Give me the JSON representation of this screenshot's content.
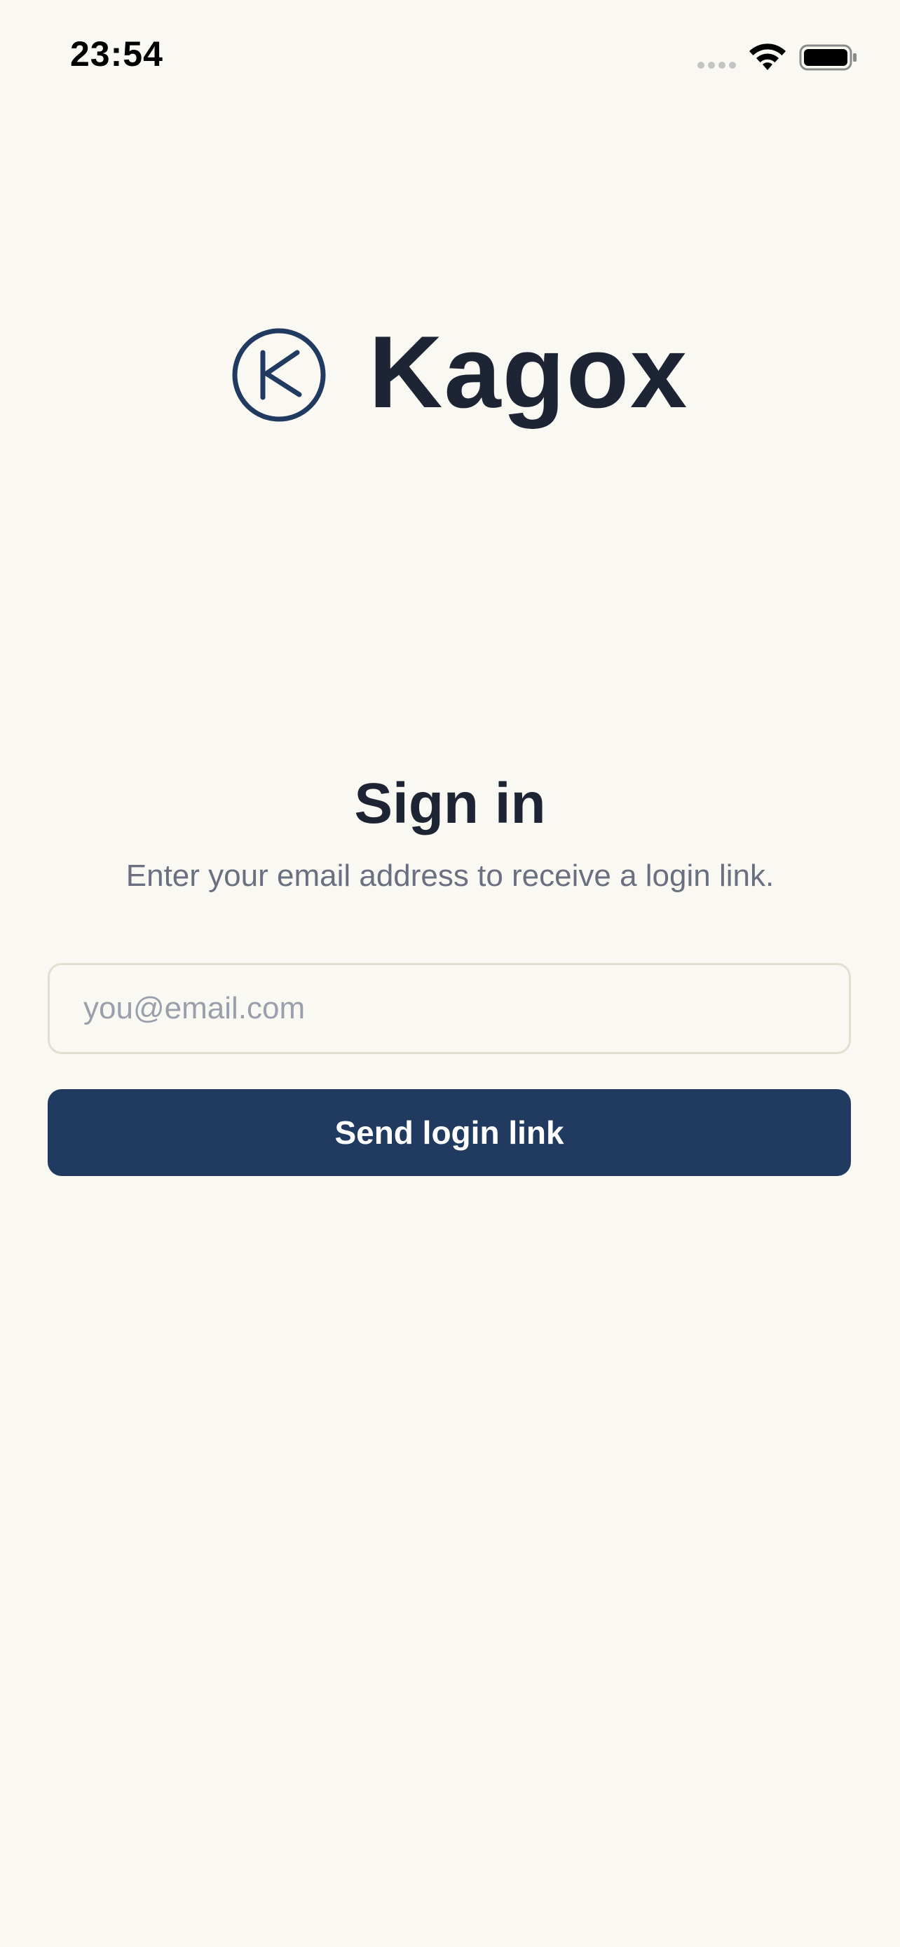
{
  "status_bar": {
    "time": "23:54",
    "icons": [
      "signal-icon",
      "wifi-icon",
      "battery-icon"
    ]
  },
  "brand": {
    "name": "Kagox",
    "logo_icon": "circle-k-logo-icon",
    "primary_color": "#203a60",
    "text_color": "#1d2433",
    "background_color": "#faf8f2"
  },
  "signin": {
    "title": "Sign in",
    "subtitle": "Enter your email address to receive a login link.",
    "email_placeholder": "you@email.com",
    "email_value": "",
    "button_label": "Send login link"
  }
}
